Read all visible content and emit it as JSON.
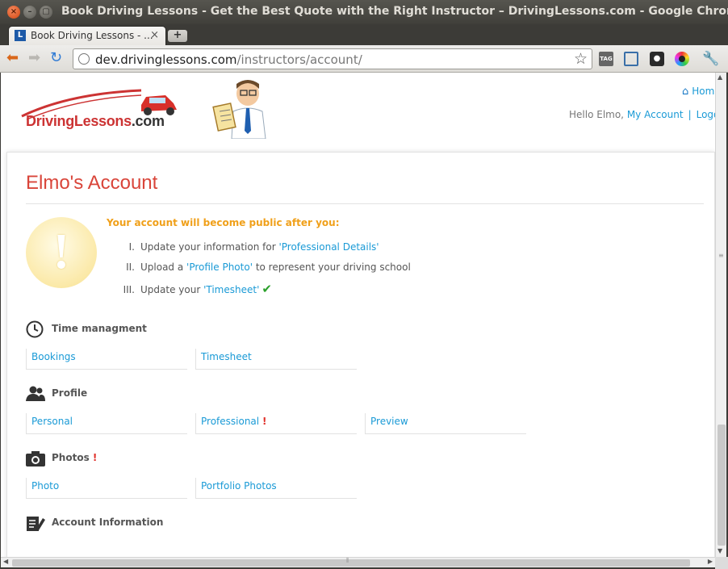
{
  "window": {
    "title": "Book Driving Lessons - Get the Best Quote with the Right Instructor – DrivingLessons.com - Google Chrome"
  },
  "tab": {
    "label": "Book Driving Lessons - ...",
    "favicon": "L"
  },
  "omnibox": {
    "host": "dev.drivinglessons.com",
    "path": "/instructors/account/"
  },
  "header": {
    "logo_main": "DrivingLessons",
    "logo_suffix": ".com",
    "home_label": "Hom",
    "greeting": "Hello Elmo,",
    "my_account": "My Account",
    "separator": "|",
    "logout": "Logo"
  },
  "main": {
    "title": "Elmo's Account",
    "notice": {
      "heading": "Your account will become public after you:",
      "steps": [
        {
          "num": "I.",
          "pre": "Update your information for ",
          "link": "'Professional Details'",
          "post": ""
        },
        {
          "num": "II.",
          "pre": "Upload a ",
          "link": "'Profile Photo'",
          "post": " to represent your driving school"
        },
        {
          "num": "III.",
          "pre": "Update your ",
          "link": "'Timesheet'",
          "post": ""
        }
      ],
      "done_mark": "✔"
    },
    "sections": [
      {
        "title": "Time managment",
        "alert": "",
        "links": [
          "Bookings",
          "Timesheet"
        ]
      },
      {
        "title": "Profile",
        "alert": "",
        "links": [
          "Personal",
          "Professional",
          "Preview"
        ],
        "link_alert": "!"
      },
      {
        "title": "Photos",
        "alert": "!",
        "links": [
          "Photo",
          "Portfolio Photos"
        ]
      },
      {
        "title": "Account Information",
        "alert": ""
      }
    ]
  },
  "icons": {
    "back": "back-arrow-icon",
    "forward": "forward-arrow-icon",
    "reload": "reload-icon",
    "star": "bookmark-star-icon",
    "wrench": "wrench-icon"
  },
  "colors": {
    "title_red": "#d9453a",
    "link_blue": "#1a9ad6",
    "notice_orange": "#f0a01a",
    "check_green": "#2aa02a"
  }
}
